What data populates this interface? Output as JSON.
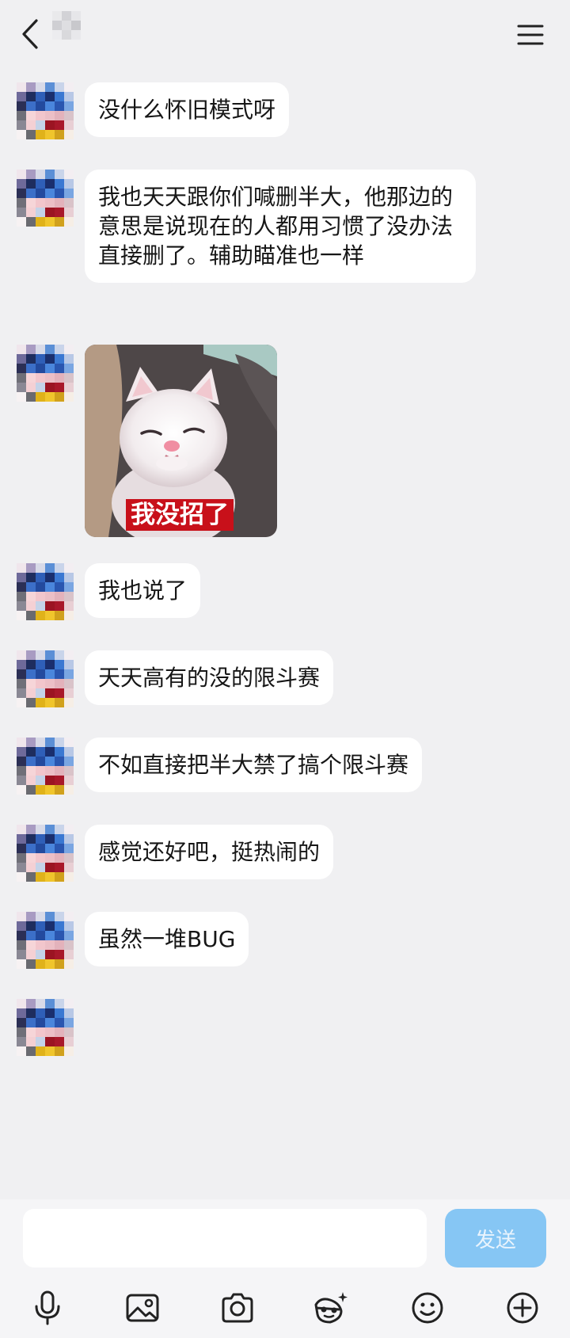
{
  "messages": [
    {
      "type": "text",
      "text": "没什么怀旧模式呀"
    },
    {
      "type": "text",
      "text": "我也天天跟你们喊删半大，他那边的意思是说现在的人都用习惯了没办法直接删了。辅助瞄准也一样"
    },
    {
      "type": "image",
      "caption": "我没招了"
    },
    {
      "type": "text",
      "text": "我也说了"
    },
    {
      "type": "text",
      "text": "天天高有的没的限斗赛"
    },
    {
      "type": "text",
      "text": "不如直接把半大禁了搞个限斗赛"
    },
    {
      "type": "text",
      "text": "感觉还好吧，挺热闹的"
    },
    {
      "type": "text",
      "text": "虽然一堆BUG"
    },
    {
      "type": "empty"
    }
  ],
  "input": {
    "value": "",
    "send_label": "发送"
  },
  "toolbar": [
    "microphone-icon",
    "image-icon",
    "camera-icon",
    "sticker-icon",
    "emoji-icon",
    "plus-icon"
  ],
  "colors": {
    "background": "#f0f0f2",
    "bubble": "#ffffff",
    "send_button": "#86c6f4",
    "caption_bg": "#c8101a"
  }
}
